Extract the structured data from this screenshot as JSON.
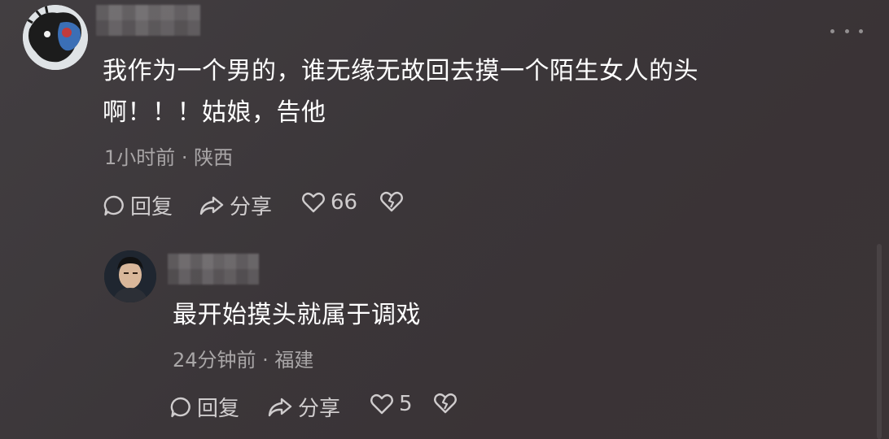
{
  "main_comment": {
    "text_line1": "我作为一个男的，谁无缘无故回去摸一个陌生女人的头",
    "text_line2": "啊！！！姑娘，告他",
    "meta": "1小时前 · 陕西",
    "actions": {
      "reply_label": "回复",
      "share_label": "分享",
      "like_count": "66"
    }
  },
  "reply_comment": {
    "text": "最开始摸头就属于调戏",
    "meta": "24分钟前 · 福建",
    "actions": {
      "reply_label": "回复",
      "share_label": "分享",
      "like_count": "5"
    }
  },
  "icons": {
    "comment": "comment-bubble-icon",
    "share": "share-arrow-icon",
    "like": "heart-outline-icon",
    "dislike": "broken-heart-icon",
    "more": "more-dots-icon"
  },
  "colors": {
    "background": "#3d383b",
    "text": "#ffffff",
    "meta_text": "#a9a6a7",
    "action_text": "#cfcccd"
  }
}
